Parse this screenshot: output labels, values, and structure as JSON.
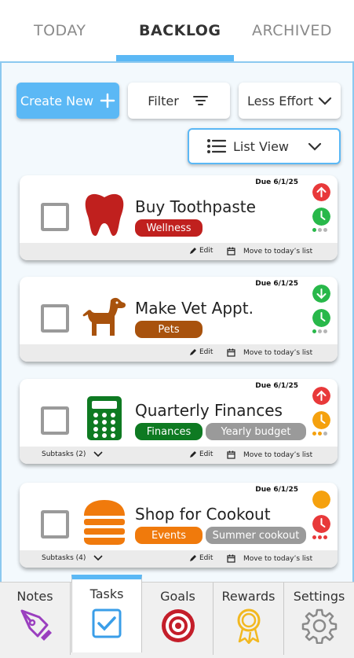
{
  "tabs": [
    "TODAY",
    "BACKLOG",
    "ARCHIVED"
  ],
  "toolbar": {
    "create_label": "Create New",
    "filter_label": "Filter",
    "sort_label": "Less Effort",
    "view_label": "List View"
  },
  "tasks": [
    {
      "title": "Buy Toothpaste",
      "due": "Due 6/1/25",
      "tags": [
        {
          "label": "Wellness",
          "color": "#c0201e"
        }
      ],
      "priority": "high",
      "effort": "low",
      "edit_label": "Edit",
      "move_label": "Move to today’s list",
      "subtasks_label": ""
    },
    {
      "title": "Make Vet Appt.",
      "due": "Due 6/1/25",
      "tags": [
        {
          "label": "Pets",
          "color": "#a8520d"
        }
      ],
      "priority": "low",
      "effort": "low",
      "edit_label": "Edit",
      "move_label": "Move to today’s list",
      "subtasks_label": ""
    },
    {
      "title": "Quarterly Finances",
      "due": "Due 6/1/25",
      "tags": [
        {
          "label": "Finances",
          "color": "#0e7a22"
        },
        {
          "label": "Yearly budget",
          "color": "#9a9a9a"
        }
      ],
      "priority": "high",
      "effort": "medium",
      "edit_label": "Edit",
      "move_label": "Move to today’s list",
      "subtasks_label": "Subtasks (2)"
    },
    {
      "title": "Shop for Cookout",
      "due": "Due 6/1/25",
      "tags": [
        {
          "label": "Events",
          "color": "#f07a0c"
        },
        {
          "label": "Summer cookout",
          "color": "#9a9a9a"
        }
      ],
      "priority": "medium",
      "effort": "high",
      "edit_label": "Edit",
      "move_label": "Move to today’s list",
      "subtasks_label": "Subtasks (4)"
    }
  ],
  "nav": [
    "Notes",
    "Tasks",
    "Goals",
    "Rewards",
    "Settings"
  ],
  "colors": {
    "accent": "#5bb8f5",
    "priority_high": "#e8393a",
    "priority_low": "#28b84a",
    "priority_medium": "#f5a10e",
    "effort_low": "#28b84a",
    "effort_medium": "#f5a10e",
    "effort_high": "#e8393a"
  },
  "icons": {
    "task_icons": [
      "tooth-icon",
      "dog-icon",
      "calculator-icon",
      "burger-icon"
    ],
    "nav_icons": [
      "pen-icon",
      "checkbox-icon",
      "target-icon",
      "medal-icon",
      "gear-icon"
    ]
  }
}
